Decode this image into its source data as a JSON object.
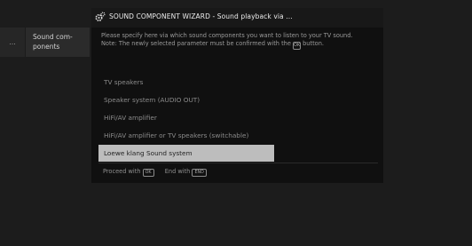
{
  "side_menu": {
    "prev_label": "...",
    "current_label_line1": "Sound com-",
    "current_label_line2": "ponents"
  },
  "wizard": {
    "title": "SOUND COMPONENT WIZARD - Sound playback via ...",
    "description_line1": "Please specify here via which sound components you want to listen to your TV sound.",
    "note_before": "Note: The newly selected parameter must be confirmed with the",
    "note_key": "OK",
    "note_after": "button.",
    "options": [
      "TV speakers",
      "Speaker system (AUDIO OUT)",
      "HiFi/AV amplifier",
      "HiFi/AV amplifier or TV speakers (switchable)",
      "Loewe klang Sound system"
    ],
    "selected_index": 4,
    "footer": {
      "proceed_label": "Proceed with",
      "proceed_key": "OK",
      "end_label": "End with",
      "end_key": "END"
    }
  },
  "colors": {
    "background": "#1c1c1c",
    "panel": "#101010",
    "selected_bg": "#bdbdbd",
    "text": "#9a9a9a"
  }
}
